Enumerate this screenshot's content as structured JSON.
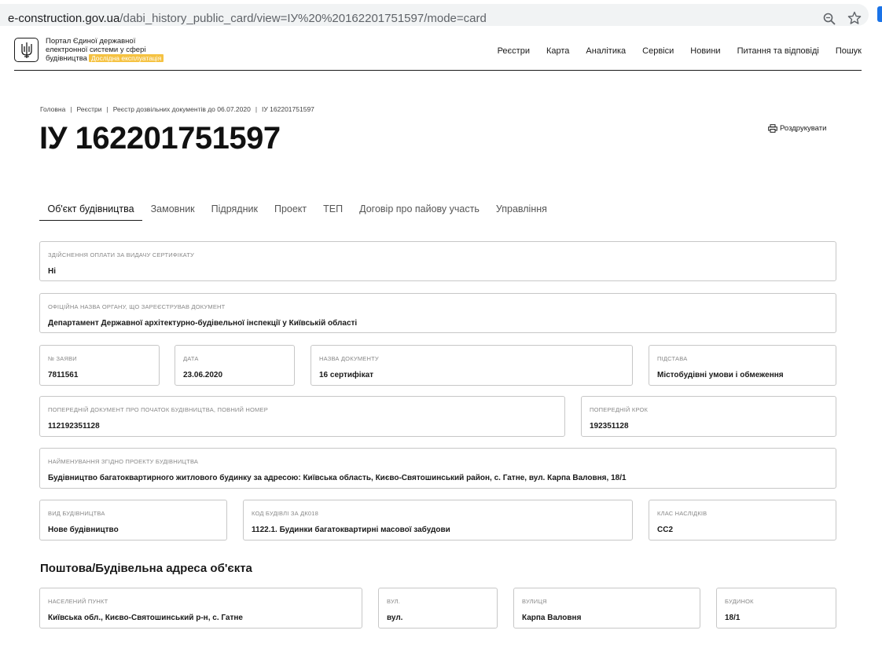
{
  "browser": {
    "url_host": "e-construction.gov.ua",
    "url_path": "/dabi_history_public_card/view=ІУ%20%20162201751597/mode=card"
  },
  "header": {
    "brand_line1": "Портал Єдиної державної",
    "brand_line2": "електронної системи у сфері",
    "brand_line3": "будівництва",
    "badge": "Дослідна експлуатація",
    "nav": [
      "Реєстри",
      "Карта",
      "Аналітика",
      "Сервіси",
      "Новини",
      "Питання та відповіді",
      "Пошук"
    ]
  },
  "breadcrumb": [
    "Головна",
    "Реєстри",
    "Реєстр дозвільних документів до 06.07.2020",
    "ІУ 162201751597"
  ],
  "page_title": "ІУ 162201751597",
  "print_label": "Роздрукувати",
  "tabs": [
    "Об'єкт будівництва",
    "Замовник",
    "Підрядник",
    "Проект",
    "ТЕП",
    "Договір про пайову участь",
    "Управління"
  ],
  "fields": {
    "payment": {
      "label": "Здійснення оплати за видачу сертифікату",
      "value": "Ні"
    },
    "authority": {
      "label": "Офіційна назва органу, що зареєстрував документ",
      "value": "Департамент Державної архітектурно-будівельної інспекції у Київській області"
    },
    "app_no": {
      "label": "№ заяви",
      "value": "7811561"
    },
    "date": {
      "label": "Дата",
      "value": "23.06.2020"
    },
    "doc_name": {
      "label": "Назва документу",
      "value": "16 сертифікат"
    },
    "basis": {
      "label": "Підстава",
      "value": "Містобудівні умови і обмеження"
    },
    "prev_doc": {
      "label": "Попередній документ про початок будівництва, повний номер",
      "value": "112192351128"
    },
    "prev_step": {
      "label": "Попередній крок",
      "value": "192351128"
    },
    "project_name": {
      "label": "Найменування згідно проекту будівництва",
      "value": "Будівництво багатоквартирного житлового будинку за адресою: Київська область, Києво-Святошинський район, с. Гатне, вул. Карпа Валовня, 18/1"
    },
    "construction_type": {
      "label": "Вид будівництва",
      "value": "Нове будівництво"
    },
    "building_code": {
      "label": "Код будівлі за ДК018",
      "value": "1122.1. Будинки багатоквартирні масової забудови"
    },
    "consequence_class": {
      "label": "Клас наслідків",
      "value": "СС2"
    }
  },
  "address_section": {
    "heading": "Поштова/Будівельна адреса об'єкта",
    "settlement": {
      "label": "Населений пункт",
      "value": "Київська обл., Києво-Святошинський р-н, с. Гатне"
    },
    "street_type": {
      "label": "Вул.",
      "value": "вул."
    },
    "street": {
      "label": "Вулиця",
      "value": "Карпа Валовня"
    },
    "building": {
      "label": "Будинок",
      "value": "18/1"
    }
  }
}
